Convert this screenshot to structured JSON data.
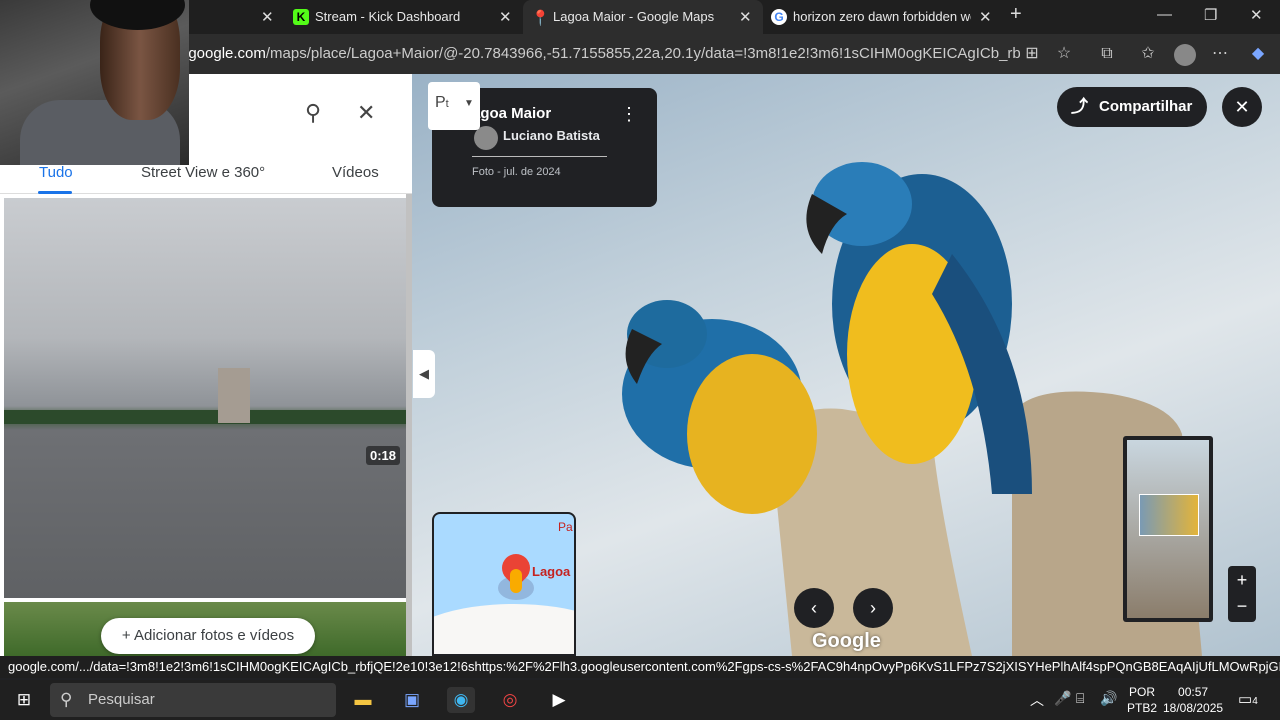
{
  "browser": {
    "tabs": [
      {
        "title": "Stream - Kick Dashboard",
        "favicon": "kick-icon",
        "active": false
      },
      {
        "title": "Lagoa Maior - Google Maps",
        "favicon": "maps-pin-icon",
        "active": true
      },
      {
        "title": "horizon zero dawn forbidden wes",
        "favicon": "google-icon",
        "active": false
      }
    ],
    "new_tab": "+",
    "url_prefix": "r.google.com",
    "url_rest": "/maps/place/Lagoa+Maior/@-20.7843966,-51.7155855,22a,20.1y/data=!3m8!1e2!3m6!1sCIHM0ogKEICAgICb_rbfjQE!2e..."
  },
  "sidebar": {
    "tabs": [
      {
        "label": "Tudo",
        "active": true
      },
      {
        "label": "Street View e 360°",
        "active": false
      },
      {
        "label": "Vídeos",
        "active": false
      }
    ],
    "video_duration": "0:18",
    "add_button": "Adicionar fotos e vídeos",
    "add_icon": "+"
  },
  "viewer": {
    "card_title": "agoa Maior",
    "author": "Luciano Batista",
    "date": "Foto - jul. de 2024",
    "share_label": "Compartilhar",
    "minimap_label": "Lagoa",
    "minimap_pa": "Pa",
    "google_logo": "Google",
    "pegman_label": "P",
    "pegman_sub": "t"
  },
  "status_bar": "google.com/.../data=!3m8!1e2!3m6!1sCIHM0ogKEICAgICb_rbfjQE!2e10!3e12!6shttps:%2F%2Flh3.googleusercontent.com%2Fgps-cs-s%2FAC9h4npOvyPp6KvS1LFPz7S2jXISYHePlhAlf4spPQnGB8EAqAIjUfLMOwRpjGP2hhUnzHhQ0tkx...",
  "taskbar": {
    "search_placeholder": "Pesquisar",
    "lang_top": "POR",
    "lang_bottom": "PTB2",
    "time": "00:57",
    "date": "18/08/2025",
    "notifications": "4"
  },
  "colors": {
    "accent": "#1a73e8",
    "dark": "#202124"
  }
}
